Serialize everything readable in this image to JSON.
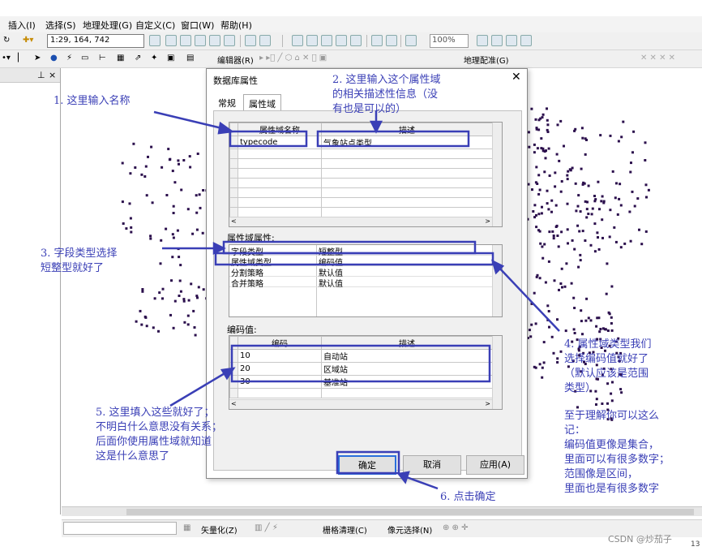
{
  "menubar": {
    "items": [
      "插入(I)",
      "选择(S)",
      "地理处理(G)",
      "自定义(C)",
      "窗口(W)",
      "帮助(H)"
    ]
  },
  "toolbar": {
    "scale": "1:29, 164, 742",
    "zoom": "100%",
    "editor_label": "编辑器(R)",
    "geo_config_label": "地理配准(G)"
  },
  "bottom_toolbar": {
    "vectorize": "矢量化(Z)",
    "raster_cleanup": "栅格清理(C)",
    "pixel_select": "像元选择(N)"
  },
  "left_panel": {
    "pin": "⊥",
    "close": "×"
  },
  "dialog": {
    "title": "数据库属性",
    "close": "✕",
    "tabs": [
      "常规",
      "属性域"
    ],
    "domain_table": {
      "headers": [
        "属性域名称",
        "描述"
      ],
      "rows": [
        [
          "typecode",
          "气象站点类型"
        ]
      ]
    },
    "props_label": "属性域属性:",
    "props": [
      {
        "key": "字段类型",
        "value": "短整型"
      },
      {
        "key": "属性域类型",
        "value": "编码值"
      },
      {
        "key": "分割策略",
        "value": "默认值"
      },
      {
        "key": "合并策略",
        "value": "默认值"
      }
    ],
    "coded_label": "编码值:",
    "coded_table": {
      "headers": [
        "编码",
        "描述"
      ],
      "rows": [
        [
          "10",
          "自动站"
        ],
        [
          "20",
          "区域站"
        ],
        [
          "30",
          "基准站"
        ]
      ]
    },
    "buttons": {
      "ok": "确定",
      "cancel": "取消",
      "apply": "应用(A)"
    }
  },
  "annotations": {
    "a1": "1. 这里输入名称",
    "a2": "2. 这里输入这个属性域\n的相关描述性信息（没\n有也是可以的）",
    "a3": "3. 字段类型选择\n短整型就好了",
    "a4": "4. 属性域类型我们\n选择编码值就好了\n（默认应该是范围\n类型）",
    "a5": "5. 这里填入这些就好了；\n不明白什么意思没有关系；\n后面你使用属性域就知道\n这是什么意思了",
    "a6": "6. 点击确定",
    "a7": "至于理解你可以这么\n记：\n编码值更像是集合，\n里面可以有很多数字；\n范围像是区间，\n里面也是有很多数字",
    "color": "#3a3fb6"
  },
  "watermark": "CSDN @炒茄子",
  "corner_number": "13"
}
